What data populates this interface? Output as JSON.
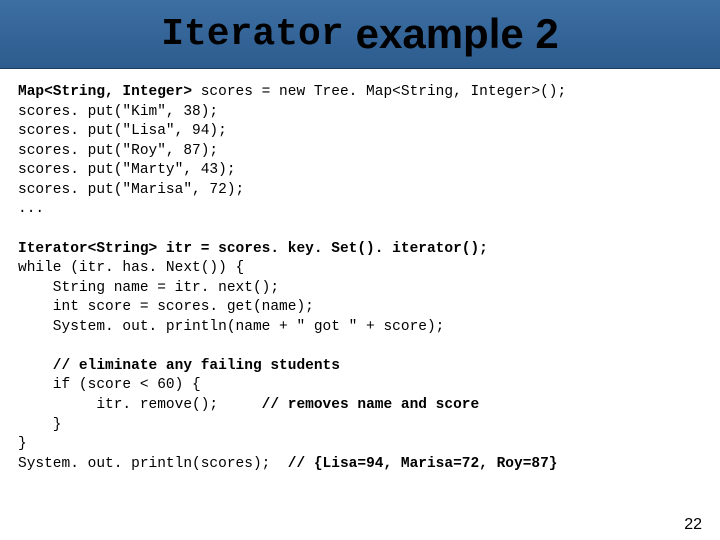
{
  "title": {
    "mono": "Iterator",
    "sans": "example 2"
  },
  "code": {
    "l1a": "Map<String, Integer>",
    "l1b": " scores = new Tree. Map<String, Integer>();",
    "l2": "scores. put(\"Kim\", 38);",
    "l3": "scores. put(\"Lisa\", 94);",
    "l4": "scores. put(\"Roy\", 87);",
    "l5": "scores. put(\"Marty\", 43);",
    "l6": "scores. put(\"Marisa\", 72);",
    "l7": "...",
    "l8": "Iterator<String> itr = scores. key. Set(). iterator();",
    "l9": "while (itr. has. Next()) {",
    "l10": "    String name = itr. next();",
    "l11": "    int score = scores. get(name);",
    "l12": "    System. out. println(name + \" got \" + score);",
    "l13": "    // eliminate any failing students",
    "l14a": "    if (score < 60) {",
    "l15a": "         itr. remove();",
    "l15b": "     // removes name and score",
    "l16": "    }",
    "l17": "}",
    "l18a": "System. out. println(scores);  ",
    "l18b": "// {Lisa=94, Marisa=72, Roy=87}"
  },
  "page_number": "22"
}
